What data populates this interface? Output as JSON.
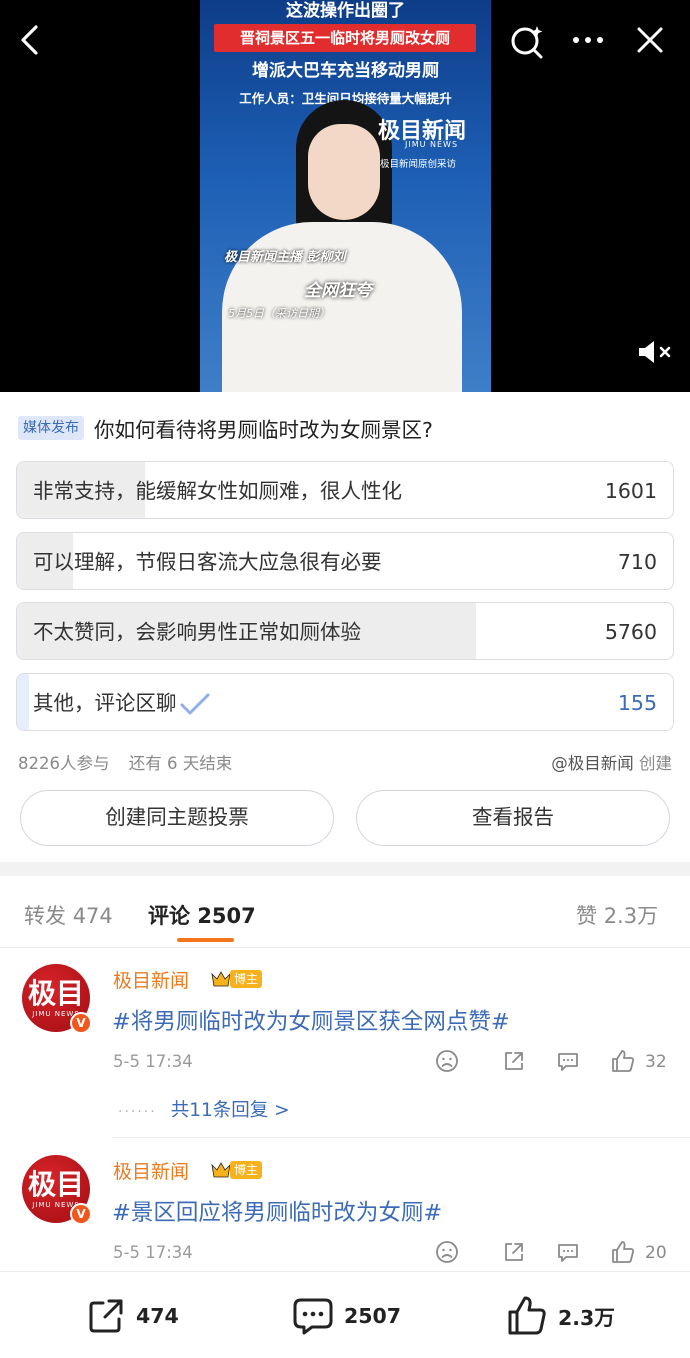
{
  "video": {
    "caption_top": "这波操作出圈了",
    "caption_red": "晋祠景区五一临时将男厕改女厕",
    "caption_line2": "增派大巴车充当移动男厕",
    "caption_line3": "工作人员：卫生间日均接待量大幅提升",
    "logo": "极目新闻",
    "logo_en": "JIMU NEWS",
    "logo_sub": "极目新闻原创采访",
    "anchor_tag": "极目新闻主播 彭柳刘",
    "praise": "全网狂夸",
    "date_tag": "5月5日（采访日期）"
  },
  "poll": {
    "tag": "媒体发布",
    "question": "你如何看待将男厕临时改为女厕景区?",
    "options": [
      {
        "label": "非常支持，能缓解女性如厕难，很人性化",
        "count": "1601",
        "share": 0.195
      },
      {
        "label": "可以理解，节假日客流大应急很有必要",
        "count": "710",
        "share": 0.086
      },
      {
        "label": "不太赞同，会影响男性正常如厕体验",
        "count": "5760",
        "share": 0.7
      },
      {
        "label": "其他，评论区聊",
        "count": "155",
        "share": 0.019,
        "selected": true
      }
    ],
    "participants": "8226人参与",
    "remaining": "还有 6 天结束",
    "author": "@极目新闻",
    "created": "创建",
    "btn_create": "创建同主题投票",
    "btn_report": "查看报告"
  },
  "tabs": {
    "repost_label": "转发",
    "repost_count": "474",
    "comment_label": "评论",
    "comment_count": "2507",
    "like_label": "赞",
    "like_count": "2.3万"
  },
  "comments": [
    {
      "avatar_text": "极目",
      "avatar_sub": "JIMU NEWS",
      "name": "极目新闻",
      "badge": "博主",
      "text": "#将男厕临时改为女厕景区获全网点赞#",
      "time": "5-5 17:34",
      "likes": "32",
      "replies": "共11条回复 >"
    },
    {
      "avatar_text": "极目",
      "avatar_sub": "JIMU NEWS",
      "name": "极目新闻",
      "badge": "博主",
      "text": "#景区回应将男厕临时改为女厕#",
      "time": "5-5 17:34",
      "likes": "20"
    }
  ],
  "bottom_bar": {
    "repost": "474",
    "comment": "2507",
    "like": "2.3万"
  },
  "colors": {
    "link_blue": "#3d6bb8",
    "name_orange": "#eb7b21",
    "tab_accent": "#f5761a",
    "poll_tag_bg": "#dde7f7"
  }
}
